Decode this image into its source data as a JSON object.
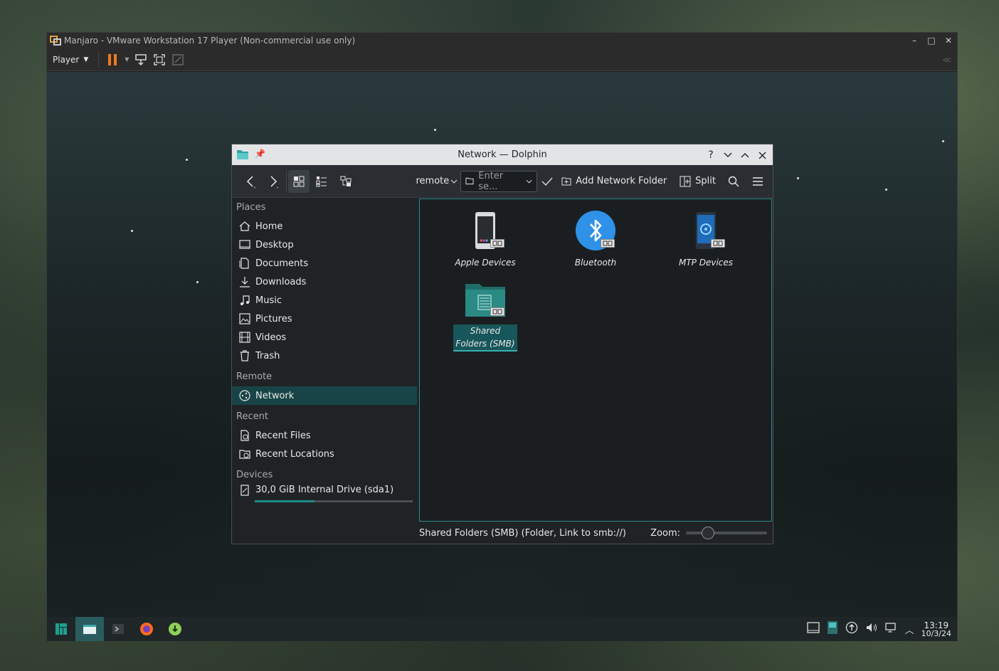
{
  "host": {
    "window_title": "Manjaro - VMware Workstation 17 Player (Non-commercial use only)",
    "player_menu_label": "Player",
    "title_controls": [
      "–",
      "□",
      "✕"
    ]
  },
  "dolphin": {
    "title": "Network — Dolphin",
    "title_controls": {
      "help": "?",
      "minimize": "⌄",
      "maximize": "⌃",
      "close": "✕"
    },
    "toolbar": {
      "location_label": "remote",
      "search_placeholder": "Enter se...",
      "add_network_folder_label": "Add Network Folder",
      "split_label": "Split"
    },
    "sidebar": {
      "sections": [
        {
          "title": "Places",
          "items": [
            {
              "label": "Home",
              "icon": "home-icon"
            },
            {
              "label": "Desktop",
              "icon": "desktop-icon"
            },
            {
              "label": "Documents",
              "icon": "documents-icon"
            },
            {
              "label": "Downloads",
              "icon": "downloads-icon"
            },
            {
              "label": "Music",
              "icon": "music-icon"
            },
            {
              "label": "Pictures",
              "icon": "pictures-icon"
            },
            {
              "label": "Videos",
              "icon": "videos-icon"
            },
            {
              "label": "Trash",
              "icon": "trash-icon"
            }
          ]
        },
        {
          "title": "Remote",
          "items": [
            {
              "label": "Network",
              "icon": "network-icon",
              "selected": true
            }
          ]
        },
        {
          "title": "Recent",
          "items": [
            {
              "label": "Recent Files",
              "icon": "recent-files-icon"
            },
            {
              "label": "Recent Locations",
              "icon": "recent-locations-icon"
            }
          ]
        },
        {
          "title": "Devices",
          "items": [
            {
              "label": "30,0 GiB Internal Drive (sda1)",
              "icon": "drive-icon",
              "capacity_used_fraction": 0.38
            }
          ]
        }
      ]
    },
    "items": [
      {
        "label": "Apple Devices",
        "icon": "apple-devices-icon"
      },
      {
        "label": "Bluetooth",
        "icon": "bluetooth-icon"
      },
      {
        "label": "MTP Devices",
        "icon": "mtp-devices-icon"
      },
      {
        "label": "Shared Folders (SMB)",
        "icon": "smb-folder-icon",
        "selected": true
      }
    ],
    "status_text": "Shared Folders (SMB) (Folder, Link to smb://)",
    "zoom_label": "Zoom:",
    "zoom_fraction": 0.27
  },
  "clock": {
    "time": "13:19",
    "date": "10/3/24"
  },
  "colors": {
    "accent": "#1e8a8a",
    "selection": "#184447",
    "pause_orange": "#f07c1a"
  }
}
